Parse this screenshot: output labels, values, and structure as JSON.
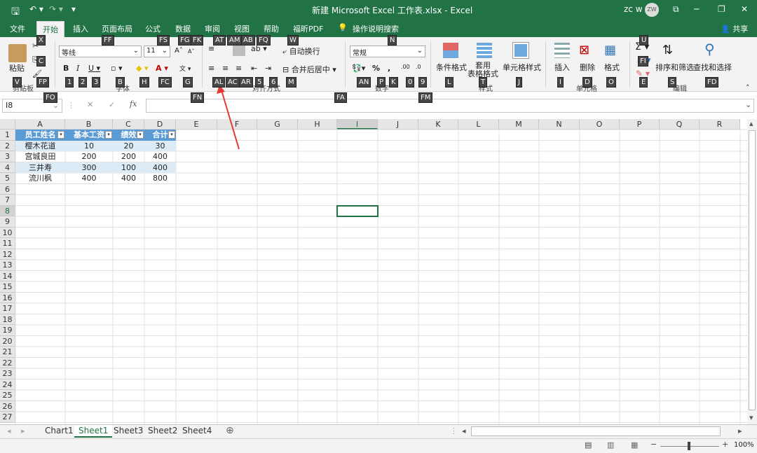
{
  "titlebar": {
    "title": "新建 Microsoft Excel 工作表.xlsx  -  Excel",
    "user": "zc w",
    "avatar": "ZW"
  },
  "tabs": [
    "文件",
    "开始",
    "插入",
    "页面布局",
    "公式",
    "数据",
    "审阅",
    "视图",
    "帮助",
    "福昕PDF"
  ],
  "tell_me": "操作说明搜索",
  "share": "共享",
  "ribbon": {
    "paste": "粘贴",
    "clipboard": "剪贴板",
    "font_name": "等线",
    "font_size": "11",
    "font_group": "字体",
    "align_group": "对齐方式",
    "wrap": "自动换行",
    "merge": "合并后居中",
    "number_format": "常规",
    "number_group": "数字",
    "cond_fmt": "条件格式",
    "table_fmt": "套用\n表格格式",
    "cell_style": "单元格样式",
    "styles_group": "样式",
    "insert": "插入",
    "delete": "删除",
    "format": "格式",
    "cells_group": "单元格",
    "sort": "排序和筛选",
    "find": "查找和选择",
    "edit_group": "编辑"
  },
  "keytips": [
    "X",
    "C",
    "FP",
    "V",
    "FO",
    "FF",
    "FS",
    "FG",
    "FK",
    "1",
    "2",
    "3",
    "B",
    "H",
    "FC",
    "G",
    "FN",
    "AT",
    "AM",
    "AB",
    "FQ",
    "W",
    "AL",
    "AC",
    "AR",
    "5",
    "6",
    "M",
    "FA",
    "N",
    "AN",
    "P",
    "K",
    "0",
    "9",
    "FM",
    "L",
    "T",
    "J",
    "I",
    "D",
    "O",
    "U",
    "FI",
    "E",
    "S",
    "FD"
  ],
  "namebox": "I8",
  "columns": [
    "A",
    "B",
    "C",
    "D",
    "E",
    "F",
    "G",
    "H",
    "I",
    "J",
    "K",
    "L",
    "M",
    "N",
    "O",
    "P",
    "Q",
    "R"
  ],
  "rows": [
    "1",
    "2",
    "3",
    "4",
    "5",
    "6",
    "7",
    "8",
    "9",
    "10",
    "11",
    "12",
    "13",
    "14",
    "15",
    "16",
    "17",
    "18",
    "19",
    "20",
    "21",
    "22",
    "23",
    "24",
    "25",
    "26",
    "27"
  ],
  "table": {
    "headers": [
      "员工姓名",
      "基本工资",
      "绩效",
      "合计"
    ],
    "data": [
      [
        "樱木花道",
        "10",
        "20",
        "30"
      ],
      [
        "宫城良田",
        "200",
        "200",
        "400"
      ],
      [
        "三井寿",
        "300",
        "100",
        "400"
      ],
      [
        "流川枫",
        "400",
        "400",
        "800"
      ]
    ]
  },
  "sheets": [
    "Chart1",
    "Sheet1",
    "Sheet3",
    "Sheet2",
    "Sheet4"
  ],
  "zoom": "100%",
  "accent": "#217346",
  "header_fill": "#5b9bd5",
  "band_fill": "#ddebf7"
}
